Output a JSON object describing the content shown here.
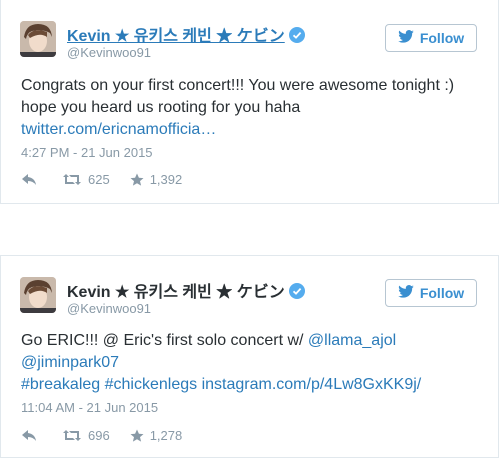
{
  "tweets": [
    {
      "display_name": "Kevin ★ 유키스 케빈 ★ ケビン",
      "handle": "@Kevinwoo91",
      "follow_label": "Follow",
      "text": "Congrats on your first concert!!! You were awesome tonight :) hope you heard us rooting for you haha",
      "link": "twitter.com/ericnamofficia…",
      "timestamp": "4:27 PM - 21 Jun 2015",
      "retweets": "625",
      "favorites": "1,392"
    },
    {
      "display_name": "Kevin ★ 유키스 케빈 ★ ケビン",
      "handle": "@Kevinwoo91",
      "follow_label": "Follow",
      "text_lead": "Go ERIC!!! @ Eric's first solo concert w/ ",
      "mention1": "@llama_ajol",
      "mention2": "@jiminpark07",
      "hashtag1": "#breakaleg",
      "hashtag2": "#chickenlegs",
      "link": "instagram.com/p/4Lw8GxKK9j/",
      "timestamp": "11:04 AM - 21 Jun 2015",
      "retweets": "696",
      "favorites": "1,278"
    }
  ],
  "colors": {
    "link": "#2b7bb9",
    "muted": "#8899a6",
    "verified": "#55acee",
    "follow": "#3a8fd0"
  }
}
